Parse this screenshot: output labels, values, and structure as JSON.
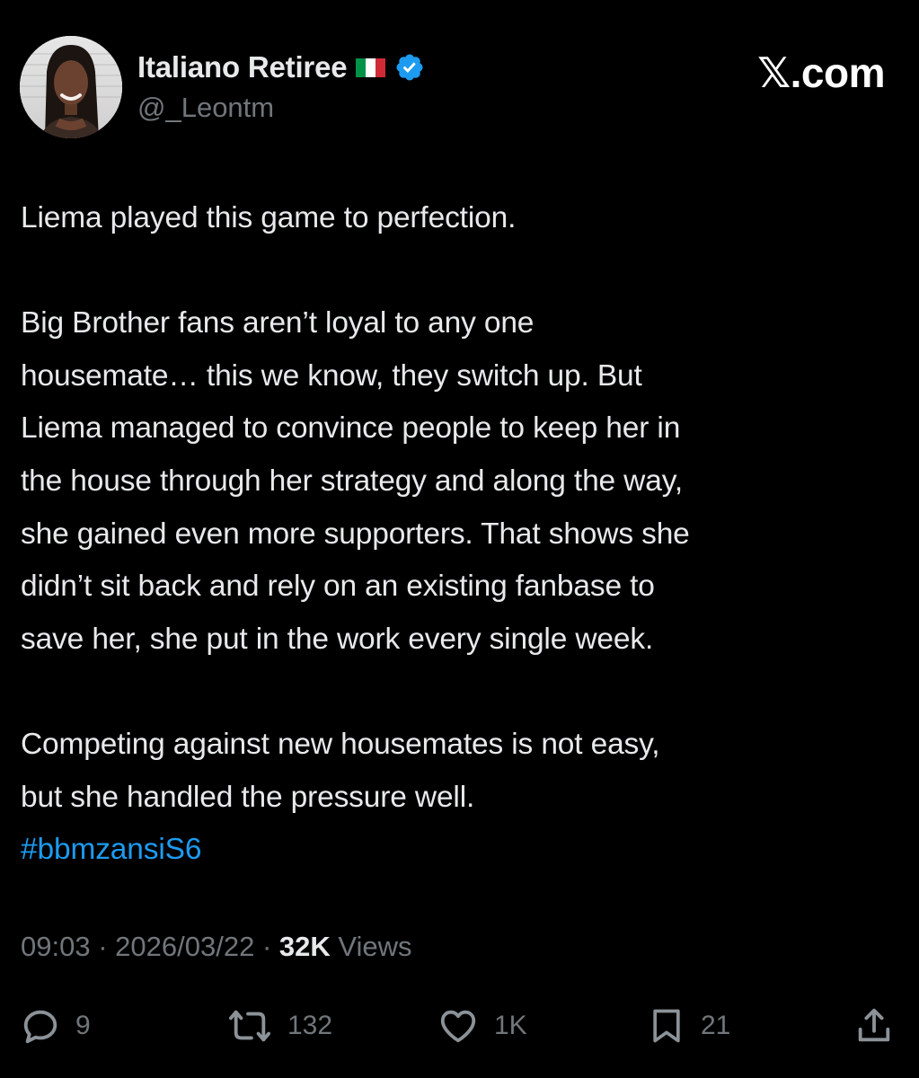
{
  "author": {
    "display_name": "Italiano Retiree",
    "flag_icon": "italy-flag-emoji",
    "flag_colors": [
      "#009246",
      "#ffffff",
      "#ce2b37"
    ],
    "verified_icon": "verified-badge-icon",
    "verified_color": "#1d9bf0",
    "handle": "@_Leontm"
  },
  "site": {
    "logo_glyph": "𝕏",
    "logo_text": ".com"
  },
  "tweet": {
    "para1": "Liema played this game to perfection.",
    "para2_lines": [
      "Big Brother fans aren’t loyal to any one",
      "housemate… this we know, they switch up. But",
      "Liema managed to convince people to keep her in",
      "the house through her strategy and along the way,",
      "she gained even more supporters. That shows she",
      "didn’t sit back and rely on an existing fanbase to",
      "save her, she put in the work every single week."
    ],
    "para3_lines": [
      "Competing against new housemates is not easy,",
      "but she handled the pressure well."
    ],
    "hashtag": "#bbmzansiS6",
    "hashtag_color": "#1d9bf0"
  },
  "meta": {
    "time": "09:03",
    "sep1": "·",
    "date": "2026/03/22",
    "sep2": "·",
    "views_count": "32K",
    "views_label": "Views"
  },
  "actions": {
    "reply": {
      "icon": "reply-icon",
      "count": "9"
    },
    "repost": {
      "icon": "repost-icon",
      "count": "132"
    },
    "like": {
      "icon": "heart-icon",
      "count": "1K"
    },
    "bookmark": {
      "icon": "bookmark-icon",
      "count": "21"
    },
    "share": {
      "icon": "share-icon"
    }
  }
}
